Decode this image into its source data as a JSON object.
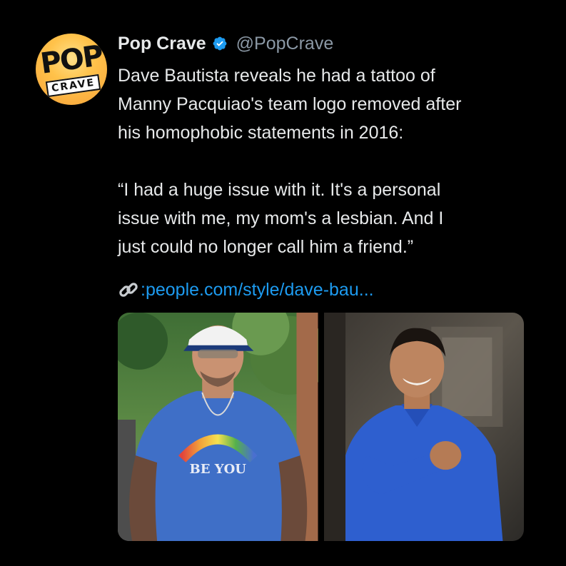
{
  "tweet": {
    "avatar": {
      "logo_top": "POP",
      "logo_bottom": "CRAVE",
      "icon": "pop-crave-logo"
    },
    "author": {
      "display_name": "Pop Crave",
      "handle": "@PopCrave",
      "verified_icon": "verified-badge-icon"
    },
    "body": {
      "line1": "Dave Bautista reveals he had a tattoo of",
      "line2": "Manny Pacquiao's team logo removed after",
      "line3": "his homophobic statements in 2016:",
      "quote1": "“I had a huge issue with it. It's a personal",
      "quote2": "issue with me, my mom's a lesbian. And I",
      "quote3": "just could no longer call him a friend.”"
    },
    "link": {
      "icon": "link-icon",
      "prefix": ":",
      "text": "people.com/style/dave-bau..."
    },
    "media": [
      {
        "description_icon": "photo-man-blue-tshirt",
        "shirt_text": "BE YOU"
      },
      {
        "description_icon": "photo-man-blue-shirt"
      }
    ]
  },
  "colors": {
    "background": "#000000",
    "text": "#e7e9ea",
    "secondary": "#8b98a5",
    "link": "#1d9bf0",
    "verified": "#1d9bf0"
  }
}
